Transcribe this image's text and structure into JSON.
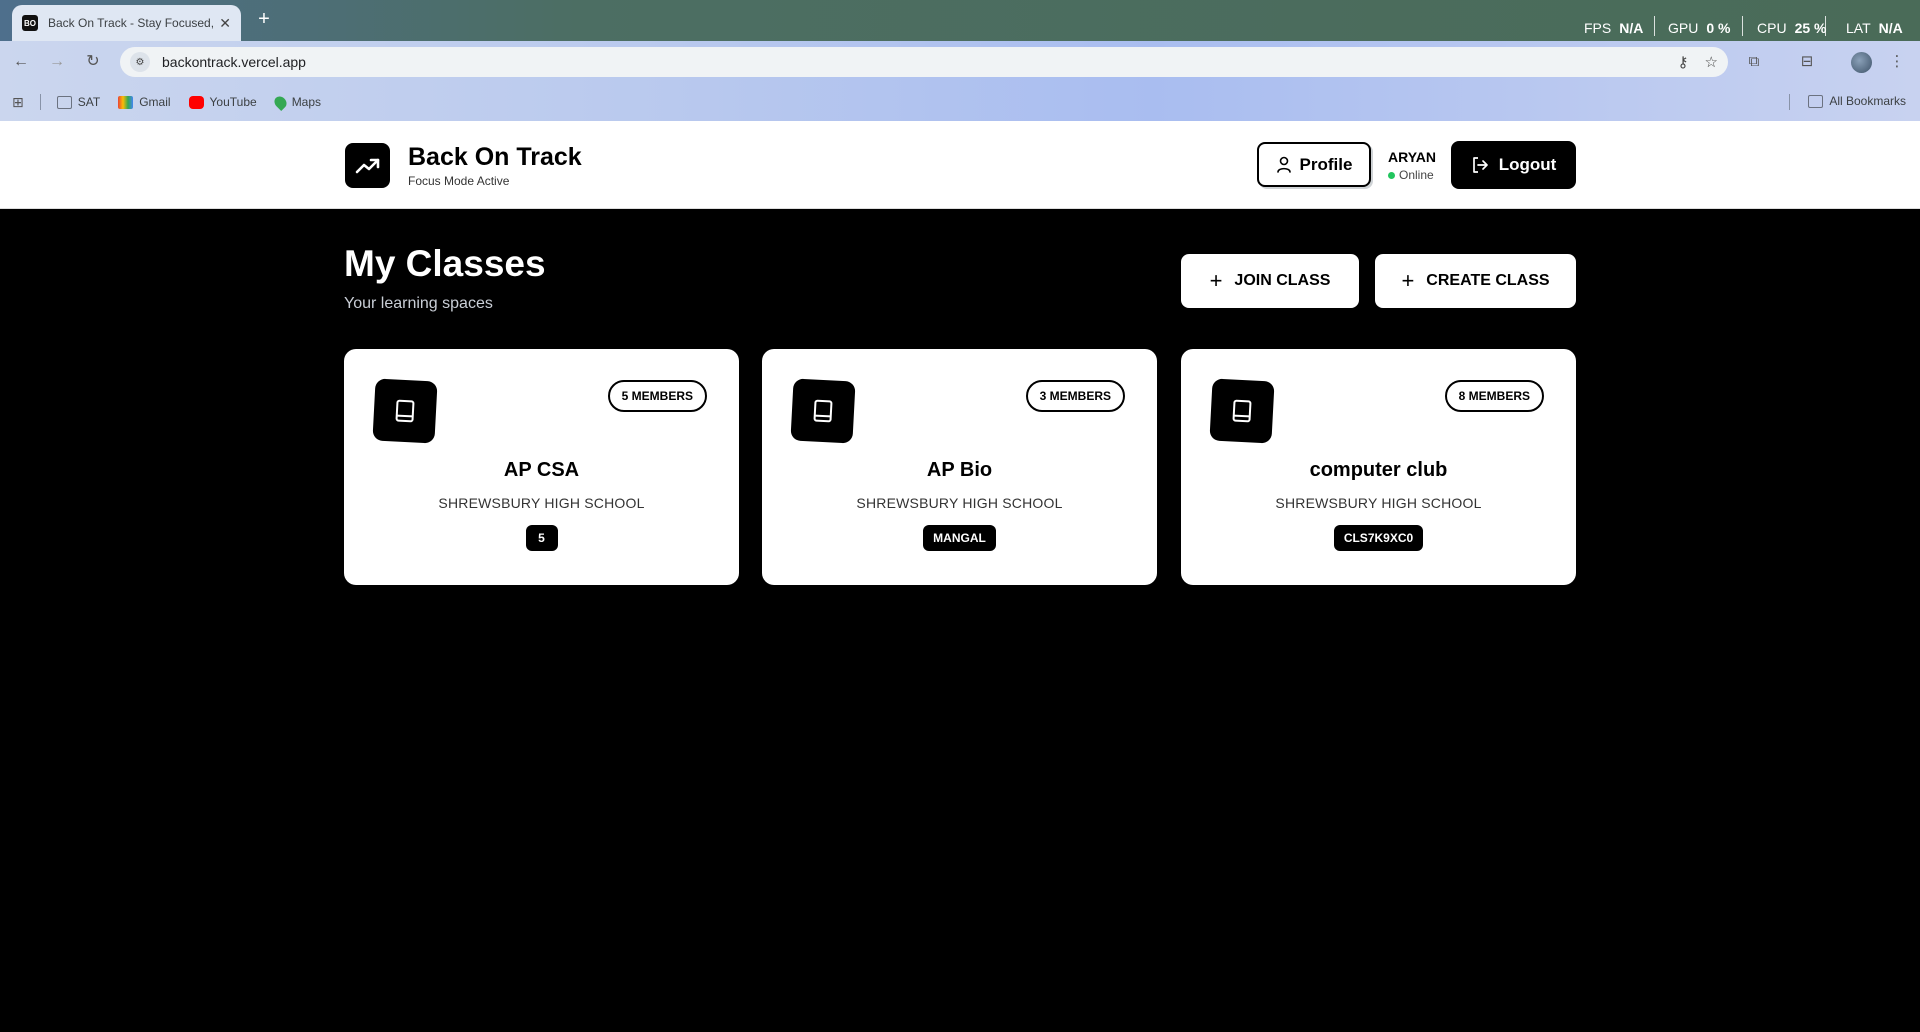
{
  "browser": {
    "tab_title": "Back On Track - Stay Focused, S",
    "favicon_text": "BO",
    "url": "backontrack.vercel.app",
    "perf": {
      "fps_label": "FPS",
      "fps_value": "N/A",
      "gpu_label": "GPU",
      "gpu_value": "0 %",
      "cpu_label": "CPU",
      "cpu_value": "25 %",
      "lat_label": "LAT",
      "lat_value": "N/A"
    },
    "bookmarks": [
      {
        "label": "SAT",
        "icon": "folder-icon"
      },
      {
        "label": "Gmail",
        "icon": "gmail-icon"
      },
      {
        "label": "YouTube",
        "icon": "youtube-icon"
      },
      {
        "label": "Maps",
        "icon": "maps-icon"
      }
    ],
    "all_bookmarks": "All Bookmarks"
  },
  "header": {
    "brand": "Back On Track",
    "subtitle": "Focus Mode Active",
    "profile_label": "Profile",
    "user_name": "ARYAN",
    "user_status": "Online",
    "logout_label": "Logout"
  },
  "main": {
    "title": "My Classes",
    "subtitle": "Your learning spaces",
    "join_label": "JOIN CLASS",
    "create_label": "CREATE CLASS",
    "classes": [
      {
        "members": "5 MEMBERS",
        "name": "AP CSA",
        "school": "SHREWSBURY HIGH SCHOOL",
        "code": "5"
      },
      {
        "members": "3 MEMBERS",
        "name": "AP Bio",
        "school": "SHREWSBURY HIGH SCHOOL",
        "code": "MANGAL"
      },
      {
        "members": "8 MEMBERS",
        "name": "computer club",
        "school": "SHREWSBURY HIGH SCHOOL",
        "code": "CLS7K9XC0"
      }
    ]
  },
  "colors": {
    "accent": "#000000",
    "page_bg": "#000000",
    "card_bg": "#ffffff",
    "online": "#22c55e"
  }
}
